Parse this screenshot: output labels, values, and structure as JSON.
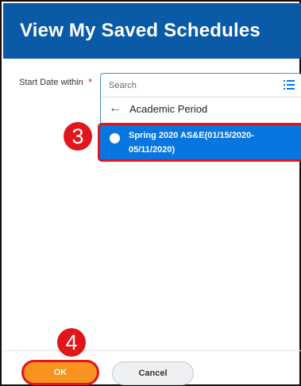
{
  "header": {
    "title": "View My Saved Schedules"
  },
  "form": {
    "field_label": "Start Date within",
    "required_marker": "*",
    "search_placeholder": "Search",
    "back_label": "Academic Period",
    "selected_option": "Spring 2020 AS&E(01/15/2020-05/11/2020)"
  },
  "annotations": {
    "step_3": "3",
    "step_4": "4"
  },
  "footer": {
    "ok_label": "OK",
    "cancel_label": "Cancel"
  },
  "colors": {
    "header_bg": "#0a5aa8",
    "selected_bg": "#0875e1",
    "ok_bg": "#f7931e",
    "annotation_red": "#e0161a",
    "required_red": "#d32f2f"
  }
}
